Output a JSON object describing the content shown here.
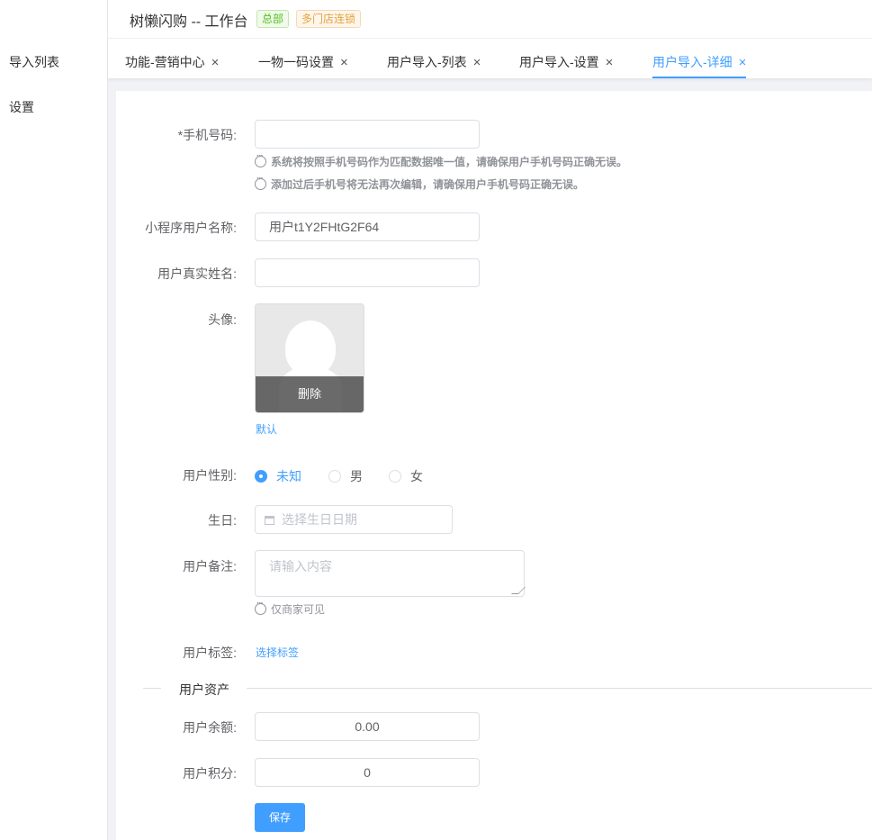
{
  "sidebar": {
    "items": [
      {
        "label": "导入列表"
      },
      {
        "label": "设置"
      }
    ]
  },
  "header": {
    "title": "树懒闪购 -- 工作台",
    "badge_hq": "总部",
    "badge_chain": "多门店连锁"
  },
  "tabs": [
    {
      "label": "功能-营销中心",
      "close": "×"
    },
    {
      "label": "一物一码设置",
      "close": "×"
    },
    {
      "label": "用户导入-列表",
      "close": "×"
    },
    {
      "label": "用户导入-设置",
      "close": "×"
    },
    {
      "label": "用户导入-详细",
      "close": "×",
      "active": true
    }
  ],
  "form": {
    "phone": {
      "label": "*手机号码:",
      "value": "",
      "tip1": "系统将按照手机号码作为匹配数据唯一值，请确保用户手机号码正确无误。",
      "tip2": "添加过后手机号将无法再次编辑，请确保用户手机号码正确无误。"
    },
    "nickname": {
      "label": "小程序用户名称:",
      "value": "用户t1Y2FHtG2F64"
    },
    "realname": {
      "label": "用户真实姓名:",
      "value": ""
    },
    "avatar": {
      "label": "头像:",
      "delete": "删除",
      "default_link": "默认"
    },
    "gender": {
      "label": "用户性别:",
      "options": [
        "未知",
        "男",
        "女"
      ],
      "selected": "未知"
    },
    "birthday": {
      "label": "生日:",
      "placeholder": "选择生日日期"
    },
    "remark": {
      "label": "用户备注:",
      "placeholder": "请输入内容",
      "tip": "仅商家可见"
    },
    "tags": {
      "label": "用户标签:",
      "link": "选择标签"
    },
    "assets_section": "用户资产",
    "balance": {
      "label": "用户余额:",
      "value": "0.00"
    },
    "points": {
      "label": "用户积分:",
      "value": "0"
    },
    "save_label": "保存"
  },
  "colors": {
    "primary": "#409eff",
    "success": "#52c41a",
    "warning": "#e6a23c"
  }
}
